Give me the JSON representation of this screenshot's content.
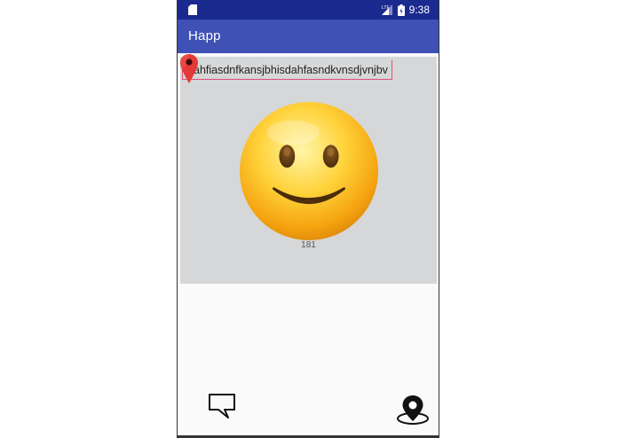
{
  "status_bar": {
    "time": "9:38",
    "network": "LTE",
    "icons": [
      "sd-card-icon",
      "signal-icon",
      "battery-icon"
    ]
  },
  "app_bar": {
    "title": "Happ"
  },
  "card": {
    "text_value": "ahfiasdnfkansjbhisdahfasndkvnsdjvnjbv",
    "count": "181",
    "pin_icon": "map-pin-icon",
    "emoji_icon": "smiley-face-icon"
  },
  "bottom_bar": {
    "left_icon": "chat-bubble-icon",
    "right_icon": "location-pin-icon"
  },
  "colors": {
    "status_bar": "#1a2a8f",
    "app_bar": "#3f51b5",
    "card_bg": "#d6d7d8",
    "field_underline": "#e04e78",
    "pin": "#e53935"
  }
}
